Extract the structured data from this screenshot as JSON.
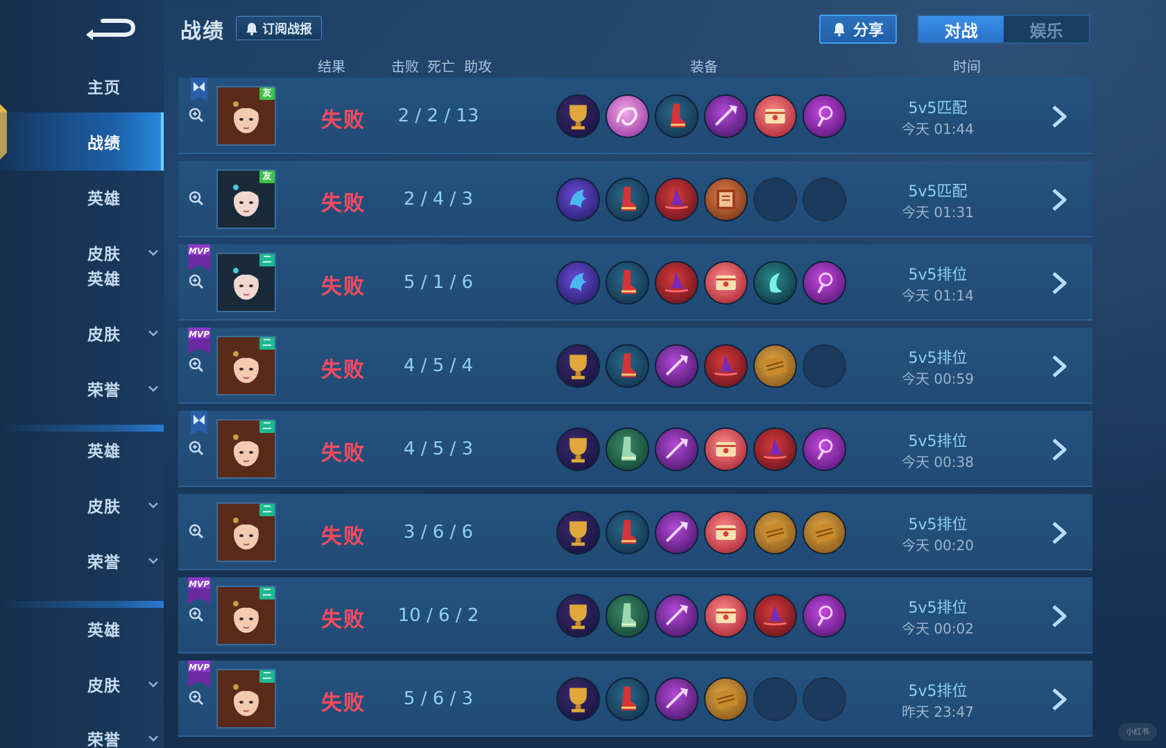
{
  "header": {
    "title": "战绩",
    "subscribe_label": "订阅战报",
    "share_label": "分享",
    "tabs": [
      {
        "label": "对战",
        "active": true
      },
      {
        "label": "娱乐",
        "active": false
      }
    ]
  },
  "sidebar": {
    "items": [
      {
        "label": "主页",
        "chevron": false,
        "active": false
      },
      {
        "label": "战绩",
        "chevron": false,
        "active": true
      },
      {
        "label": "英雄",
        "chevron": false,
        "active": false
      },
      {
        "label": "皮肤",
        "chevron": true,
        "active": false
      },
      {
        "label": "英雄",
        "chevron": false,
        "active": false
      },
      {
        "label": "皮肤",
        "chevron": true,
        "active": false
      },
      {
        "label": "荣誉",
        "chevron": true,
        "active": false
      },
      {
        "label": "英雄",
        "chevron": false,
        "active": false
      },
      {
        "label": "皮肤",
        "chevron": true,
        "active": false
      },
      {
        "label": "荣誉",
        "chevron": true,
        "active": false
      },
      {
        "label": "英雄",
        "chevron": false,
        "active": false
      },
      {
        "label": "皮肤",
        "chevron": true,
        "active": false
      },
      {
        "label": "荣誉",
        "chevron": true,
        "active": false
      }
    ]
  },
  "columns": {
    "result": "结果",
    "kills": "击败",
    "deaths": "死亡",
    "assists": "助攻",
    "items": "装备",
    "time": "时间"
  },
  "colors": {
    "defeat": "#ff4a5e",
    "kda": "#8ed0f5",
    "accent": "#2a73cc",
    "row_bg": "#214b76"
  },
  "matches": [
    {
      "badge": "butterfly-badge",
      "hero": "hero-portrait-1",
      "tag": "友",
      "result": "失败",
      "kda": "2 / 2 / 13",
      "items": [
        "trophy-item",
        "pink-swirl-item",
        "red-boots-item",
        "purple-staff-item",
        "tome-item",
        "purple-scepter-item"
      ],
      "mode": "5v5匹配",
      "time": "今天 01:44"
    },
    {
      "badge": "",
      "hero": "hero-portrait-2",
      "tag": "友",
      "result": "失败",
      "kda": "2 / 4 / 3",
      "items": [
        "blue-dragon-item",
        "red-boots-item",
        "wizard-hat-item",
        "red-book-item",
        "empty",
        "empty"
      ],
      "mode": "5v5匹配",
      "time": "今天 01:31"
    },
    {
      "badge": "mvp-badge",
      "hero": "hero-portrait-2",
      "tag": "二",
      "result": "失败",
      "kda": "5 / 1 / 6",
      "items": [
        "blue-dragon-item",
        "red-boots-item",
        "wizard-hat-item",
        "tome-item",
        "crescent-item",
        "purple-scepter-item"
      ],
      "mode": "5v5排位",
      "time": "今天 01:14"
    },
    {
      "badge": "mvp-badge",
      "hero": "hero-portrait-1",
      "tag": "二",
      "result": "失败",
      "kda": "4 / 5 / 4",
      "items": [
        "trophy-item",
        "red-boots-item",
        "purple-staff-item",
        "wizard-hat-item",
        "gold-book-item",
        "empty"
      ],
      "mode": "5v5排位",
      "time": "今天 00:59"
    },
    {
      "badge": "butterfly-badge",
      "hero": "hero-portrait-1",
      "tag": "二",
      "result": "失败",
      "kda": "4 / 5 / 3",
      "items": [
        "trophy-item",
        "green-boots-item",
        "purple-staff-item",
        "tome-item",
        "wizard-hat-item",
        "purple-scepter-item"
      ],
      "mode": "5v5排位",
      "time": "今天 00:38"
    },
    {
      "badge": "",
      "hero": "hero-portrait-1",
      "tag": "二",
      "result": "失败",
      "kda": "3 / 6 / 6",
      "items": [
        "trophy-item",
        "red-boots-item",
        "purple-staff-item",
        "tome-item",
        "gold-book-item",
        "gold-book-item"
      ],
      "mode": "5v5排位",
      "time": "今天 00:20"
    },
    {
      "badge": "mvp-badge",
      "hero": "hero-portrait-1",
      "tag": "二",
      "result": "失败",
      "kda": "10 / 6 / 2",
      "items": [
        "trophy-item",
        "green-boots-item",
        "purple-staff-item",
        "tome-item",
        "wizard-hat-item",
        "purple-scepter-item"
      ],
      "mode": "5v5排位",
      "time": "今天 00:02"
    },
    {
      "badge": "mvp-badge",
      "hero": "hero-portrait-1",
      "tag": "二",
      "result": "失败",
      "kda": "5 / 6 / 3",
      "items": [
        "trophy-item",
        "red-boots-item",
        "purple-staff-item",
        "gold-book-item",
        "empty",
        "empty"
      ],
      "mode": "5v5排位",
      "time": "昨天 23:47"
    }
  ],
  "watermark": "小红书"
}
